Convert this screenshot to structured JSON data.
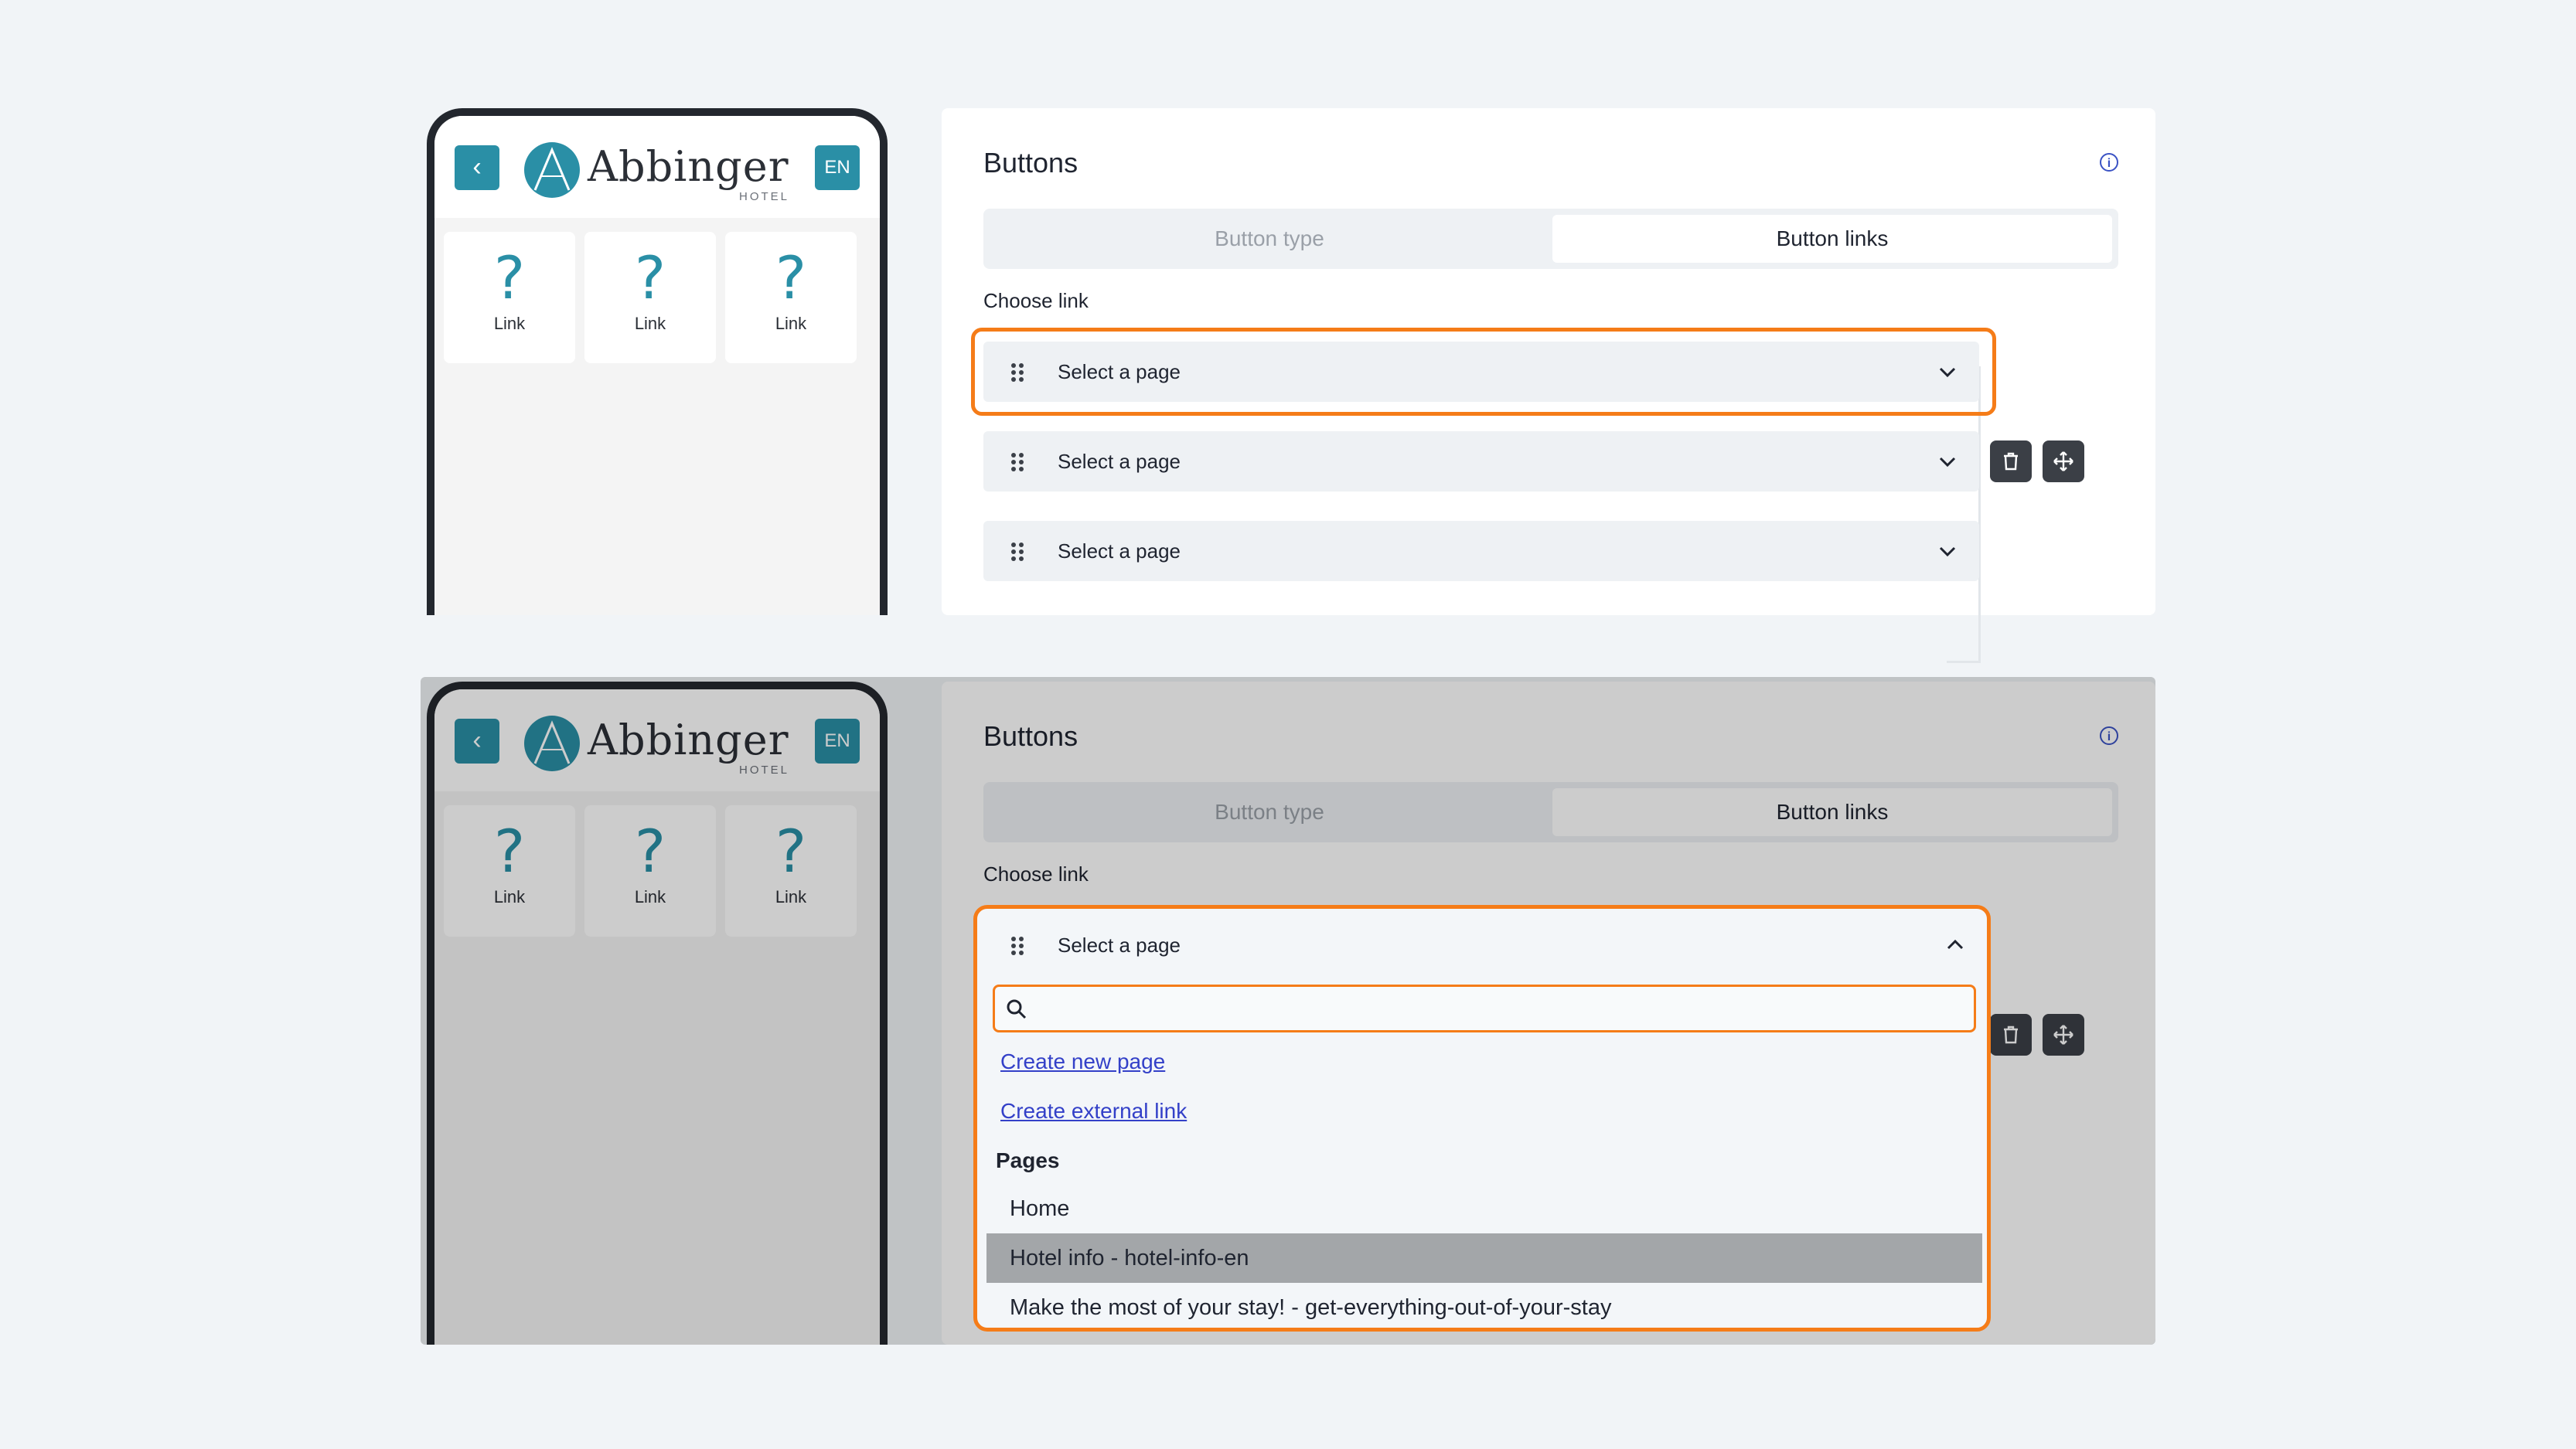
{
  "phone": {
    "back_icon": "chevron-left-icon",
    "brand": "Abbinger",
    "brand_sub": "HOTEL",
    "lang": "EN",
    "tiles": [
      {
        "icon": "?",
        "label": "Link"
      },
      {
        "icon": "?",
        "label": "Link"
      },
      {
        "icon": "?",
        "label": "Link"
      }
    ]
  },
  "editor": {
    "title": "Buttons",
    "info_icon": "i",
    "tabs": [
      "Button type",
      "Button links"
    ],
    "active_tab": "Button links",
    "choose_label": "Choose link",
    "select_placeholder": "Select a page",
    "rows": 3
  },
  "dropdown": {
    "search_placeholder": "",
    "links": [
      "Create new page",
      "Create external link"
    ],
    "pages_heading": "Pages",
    "pages": [
      "Home",
      "Hotel info - hotel-info-en",
      "Make the most of your stay! - get-everything-out-of-your-stay"
    ],
    "highlighted_index": 1
  },
  "colors": {
    "accent": "#2a8fa6",
    "highlight": "#f57c18",
    "link": "#3340c8",
    "dark_button": "#3b3f46"
  }
}
